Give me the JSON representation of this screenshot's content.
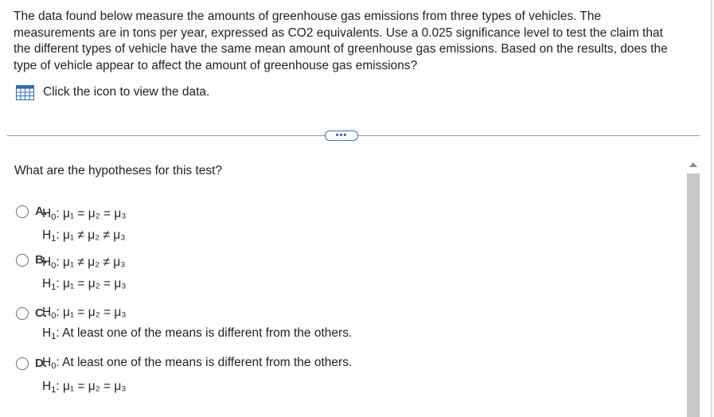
{
  "problem": {
    "text": "The data found below measure the amounts of greenhouse gas emissions from three types of vehicles. The measurements are in tons per year, expressed as CO2 equivalents. Use a 0.025 significance level to test the claim that the different types of vehicle have the same mean amount of greenhouse gas emissions. Based on the results, does the type of vehicle appear to affect the amount of greenhouse gas emissions?"
  },
  "data_link": {
    "icon": "data-table-icon",
    "label": "Click the icon to view the data."
  },
  "more_button": {
    "label": "•••"
  },
  "question": {
    "text": "What are the hypotheses for this test?"
  },
  "options": [
    {
      "letter": "A.",
      "h0": {
        "label": "H",
        "sub": "0",
        "text": ": μ₁ = μ₂ = μ₃"
      },
      "h1": {
        "label": "H",
        "sub": "1",
        "text": ": μ₁ ≠ μ₂ ≠ μ₃"
      }
    },
    {
      "letter": "B.",
      "h0": {
        "label": "H",
        "sub": "0",
        "text": ": μ₁ ≠ μ₂ ≠ μ₃"
      },
      "h1": {
        "label": "H",
        "sub": "1",
        "text": ": μ₁ = μ₂ = μ₃"
      }
    },
    {
      "letter": "C.",
      "h0": {
        "label": "H",
        "sub": "0",
        "text": ": μ₁ = μ₂ = μ₃"
      },
      "h1": {
        "label": "H",
        "sub": "1",
        "text": ": At least one of the means is different from the others."
      }
    },
    {
      "letter": "D.",
      "h0": {
        "label": "H",
        "sub": "0",
        "text": ": At least one of the means is different from the others."
      },
      "h1": {
        "label": "H",
        "sub": "1",
        "text": ": μ₁ = μ₂ = μ₃"
      }
    }
  ],
  "colors": {
    "icon_blue": "#2e6db4",
    "button_border": "#3d6fb5",
    "scroll_thumb": "#c8c8c8"
  }
}
